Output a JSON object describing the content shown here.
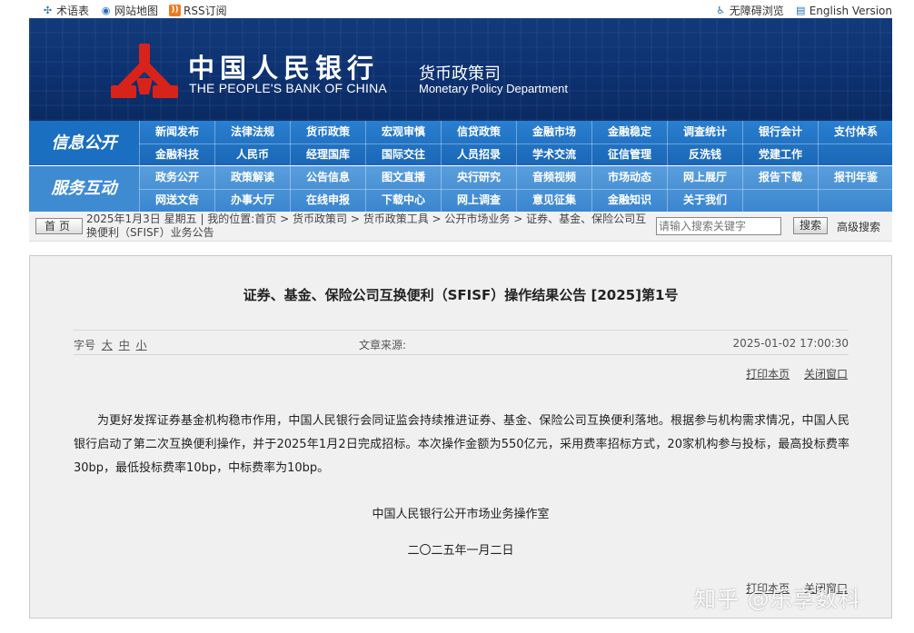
{
  "top_links": {
    "glossary": "术语表",
    "sitemap": "网站地图",
    "rss": "RSS订阅",
    "accessible": "无障碍浏览",
    "english": "English Version"
  },
  "banner": {
    "bank_cn": "中国人民银行",
    "bank_en": "THE PEOPLE'S BANK OF CHINA",
    "dept_cn": "货币政策司",
    "dept_en": "Monetary Policy Department"
  },
  "nav": {
    "group1_title": "信息公开",
    "group1_row1": [
      "新闻发布",
      "法律法规",
      "货币政策",
      "宏观审慎",
      "信贷政策",
      "金融市场",
      "金融稳定",
      "调查统计",
      "银行会计",
      "支付体系"
    ],
    "group1_row2": [
      "金融科技",
      "人民币",
      "经理国库",
      "国际交往",
      "人员招录",
      "学术交流",
      "征信管理",
      "反洗钱",
      "党建工作",
      ""
    ],
    "group2_title": "服务互动",
    "group2_row1": [
      "政务公开",
      "政策解读",
      "公告信息",
      "图文直播",
      "央行研究",
      "音频视频",
      "市场动态",
      "网上展厅",
      "报告下载",
      "报刊年鉴"
    ],
    "group2_row2": [
      "网送文告",
      "办事大厅",
      "在线申报",
      "下载中心",
      "网上调查",
      "意见征集",
      "金融知识",
      "关于我们",
      "",
      ""
    ]
  },
  "crumbbar": {
    "home": "首页",
    "location": "2025年1月3日 星期五 | 我的位置:首页 > 货币政策司 > 货币政策工具 > 公开市场业务 > 证券、基金、保险公司互换便利（SFISF）业务公告",
    "search_placeholder": "请输入搜索关键字",
    "search_button": "搜索",
    "advanced": "高级搜索"
  },
  "article": {
    "title": "证券、基金、保险公司互换便利（SFISF）操作结果公告 [2025]第1号",
    "font_label": "字号",
    "font_large": "大",
    "font_medium": "中",
    "font_small": "小",
    "source_label": "文章来源:",
    "date": "2025-01-02 17:00:30",
    "print": "打印本页",
    "close": "关闭窗口",
    "body": "为更好发挥证券基金机构稳市作用，中国人民银行会同证监会持续推进证券、基金、保险公司互换便利落地。根据参与机构需求情况，中国人民银行启动了第二次互换便利操作，并于2025年1月2日完成招标。本次操作金额为550亿元，采用费率招标方式，20家机构参与投标，最高投标费率30bp，最低投标费率10bp，中标费率为10bp。",
    "signature": "中国人民银行公开市场业务操作室",
    "sign_date": "二〇二五年一月二日"
  },
  "watermark": "知乎 @乐享数科",
  "colors": {
    "banner": "#0d3170",
    "nav_primary": "#1b6fc0",
    "nav_secondary": "#3f8bd2",
    "logo_red": "#d8231b"
  }
}
